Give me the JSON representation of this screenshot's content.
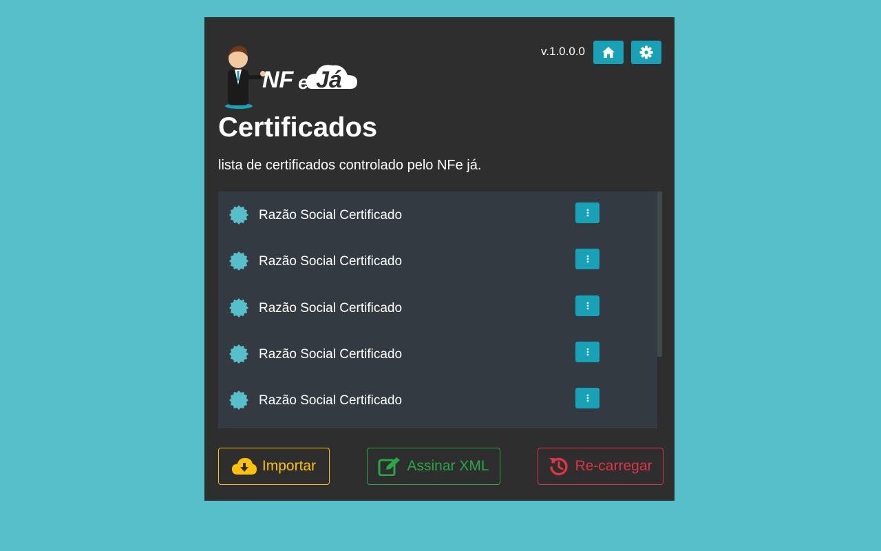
{
  "header": {
    "logo_text": "NFeJá",
    "version": "v.1.0.0.0",
    "home_icon": "home-icon",
    "settings_icon": "gear-icon"
  },
  "page": {
    "title": "Certificados",
    "subtitle": "lista de certificados  controlado pelo NFe já."
  },
  "certificates": [
    {
      "label": "Razão Social Certificado",
      "icon": "certificate-seal-icon"
    },
    {
      "label": "Razão Social Certificado",
      "icon": "certificate-seal-icon"
    },
    {
      "label": "Razão Social Certificado",
      "icon": "certificate-seal-icon"
    },
    {
      "label": "Razão Social Certificado",
      "icon": "certificate-seal-icon"
    },
    {
      "label": "Razão Social Certificado",
      "icon": "certificate-seal-icon"
    }
  ],
  "actions": {
    "import_label": "Importar",
    "sign_label": "Assinar XML",
    "reload_label": "Re-carregar"
  },
  "colors": {
    "background": "#56bfc9",
    "panel": "#2e2e2e",
    "list": "#343a42",
    "accent": "#17a2b8",
    "import": "#ffc107",
    "sign": "#28a745",
    "reload": "#dc3545"
  }
}
